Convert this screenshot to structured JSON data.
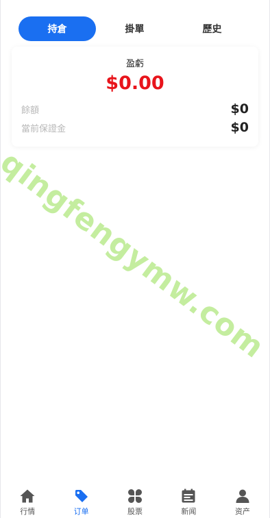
{
  "tabs": [
    {
      "label": "持倉",
      "active": true
    },
    {
      "label": "掛單",
      "active": false
    },
    {
      "label": "歷史",
      "active": false
    }
  ],
  "summary": {
    "pnl_label": "盈虧",
    "pnl_value": "$0.00",
    "balance_label": "餘額",
    "balance_value": "$0",
    "margin_label": "當前保證金",
    "margin_value": "$0"
  },
  "watermark": "qingfengymw.com",
  "bottom_nav": [
    {
      "label": "行情",
      "icon": "home-icon",
      "active": false
    },
    {
      "label": "订单",
      "icon": "tag-icon",
      "active": true
    },
    {
      "label": "股票",
      "icon": "petals-icon",
      "active": false
    },
    {
      "label": "新闻",
      "icon": "calendar-icon",
      "active": false
    },
    {
      "label": "资产",
      "icon": "user-icon",
      "active": false
    }
  ],
  "colors": {
    "accent": "#1a6ff1",
    "loss": "#e8141b",
    "watermark": "#c4ed9f"
  }
}
